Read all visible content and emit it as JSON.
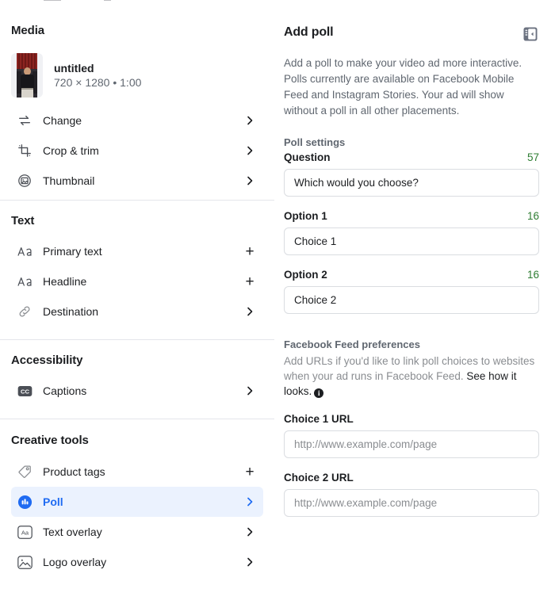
{
  "left_panel": {
    "media": {
      "section_title": "Media",
      "file_name": "untitled",
      "file_meta": "720 × 1280 • 1:00",
      "rows": [
        {
          "icon": "swap-arrows-icon",
          "label": "Change",
          "affordance": "chevron-right"
        },
        {
          "icon": "crop-icon",
          "label": "Crop & trim",
          "affordance": "chevron-right"
        },
        {
          "icon": "thumbnail-image-icon",
          "label": "Thumbnail",
          "affordance": "chevron-right"
        }
      ]
    },
    "text": {
      "section_title": "Text",
      "rows": [
        {
          "icon": "aa-text-icon",
          "label": "Primary text",
          "affordance": "plus"
        },
        {
          "icon": "aa-text-icon",
          "label": "Headline",
          "affordance": "plus"
        },
        {
          "icon": "link-icon",
          "label": "Destination",
          "affordance": "chevron-right"
        }
      ]
    },
    "accessibility": {
      "section_title": "Accessibility",
      "rows": [
        {
          "icon": "captions-cc-icon",
          "label": "Captions",
          "affordance": "chevron-right"
        }
      ]
    },
    "creative_tools": {
      "section_title": "Creative tools",
      "rows": [
        {
          "icon": "price-tag-icon",
          "label": "Product tags",
          "affordance": "plus",
          "active": false
        },
        {
          "icon": "poll-bars-icon",
          "label": "Poll",
          "affordance": "chevron-right",
          "active": true
        },
        {
          "icon": "text-overlay-icon",
          "label": "Text overlay",
          "affordance": "chevron-right",
          "active": false
        },
        {
          "icon": "logo-overlay-icon",
          "label": "Logo overlay",
          "affordance": "chevron-right",
          "active": false
        }
      ]
    }
  },
  "right_panel": {
    "title": "Add poll",
    "panel_toggle_icon": "collapse-panel-icon",
    "description": "Add a poll to make your video ad more interactive. Polls currently are available on Facebook Mobile Feed and Instagram Stories. Your ad will show without a poll in all other placements.",
    "poll_settings_label": "Poll settings",
    "fields": [
      {
        "label": "Question",
        "counter": "57",
        "value": "Which would you choose?",
        "placeholder": ""
      },
      {
        "label": "Option 1",
        "counter": "16",
        "value": "Choice 1",
        "placeholder": ""
      },
      {
        "label": "Option 2",
        "counter": "16",
        "value": "Choice 2",
        "placeholder": ""
      }
    ],
    "preferences": {
      "title": "Facebook Feed preferences",
      "body": "Add URLs if you'd like to link poll choices to websites when your ad runs in Facebook Feed.",
      "link_text": "See how it looks.",
      "info_icon": "info-icon"
    },
    "url_fields": [
      {
        "label": "Choice 1 URL",
        "value": "",
        "placeholder": "http://www.example.com/page"
      },
      {
        "label": "Choice 2 URL",
        "value": "",
        "placeholder": "http://www.example.com/page"
      }
    ]
  },
  "colors": {
    "accent_blue": "#1f6bf2",
    "active_row_bg": "#ebf2fe",
    "counter_green": "#2e7d32",
    "text_primary": "#1c1e21",
    "text_secondary": "#606770",
    "placeholder": "#8a8d91",
    "divider": "#e4e6eb"
  }
}
